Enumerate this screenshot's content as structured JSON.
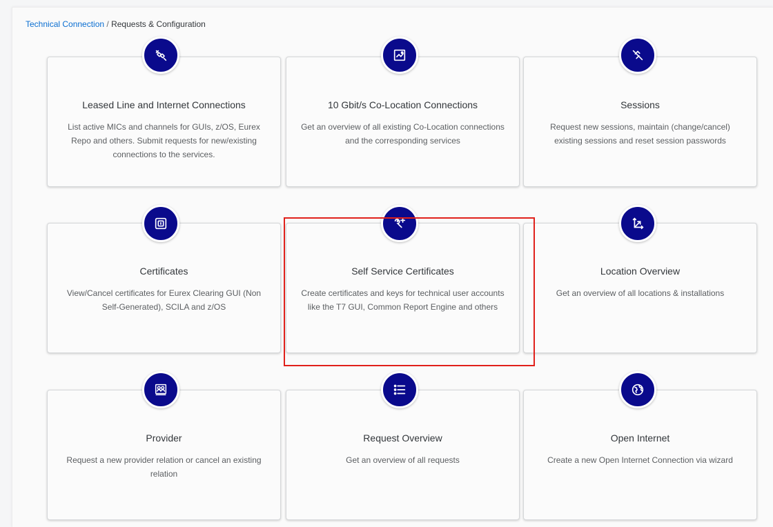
{
  "breadcrumb": {
    "link": "Technical Connection",
    "separator": " / ",
    "current": "Requests & Configuration"
  },
  "tiles": [
    {
      "title": "Leased Line and Internet Connections",
      "description": "List active MICs and channels for GUIs, z/OS, Eurex Repo and others. Submit requests for new/existing connections to the services.",
      "icon": "plug-disconnect-icon"
    },
    {
      "title": "10 Gbit/s Co-Location Connections",
      "description": "Get an overview of all existing Co-Location connections and the corresponding services",
      "icon": "network-map-icon"
    },
    {
      "title": "Sessions",
      "description": "Request new sessions, maintain (change/cancel) existing sessions and reset session passwords",
      "icon": "disconnected-icon"
    },
    {
      "title": "Certificates",
      "description": "View/Cancel certificates for Eurex Clearing GUI (Non Self-Generated), SCILA and z/OS",
      "icon": "certificate-icon"
    },
    {
      "title": "Self Service Certificates",
      "description": "Create certificates and keys for technical user accounts like the T7 GUI, Common Report Engine and others",
      "icon": "wrench-add-icon"
    },
    {
      "title": "Location Overview",
      "description": "Get an overview of all locations & installations",
      "icon": "axis-arrows-icon"
    },
    {
      "title": "Provider",
      "description": "Request a new provider relation or cancel an existing relation",
      "icon": "group-contacts-icon"
    },
    {
      "title": "Request Overview",
      "description": "Get an overview of all requests",
      "icon": "list-icon"
    },
    {
      "title": "Open Internet",
      "description": "Create a new Open Internet Connection via wizard",
      "icon": "globe-icon"
    }
  ],
  "colors": {
    "icon_circle": "#0a0a8c",
    "link": "#0a6ed1",
    "highlight": "#e0201a"
  }
}
